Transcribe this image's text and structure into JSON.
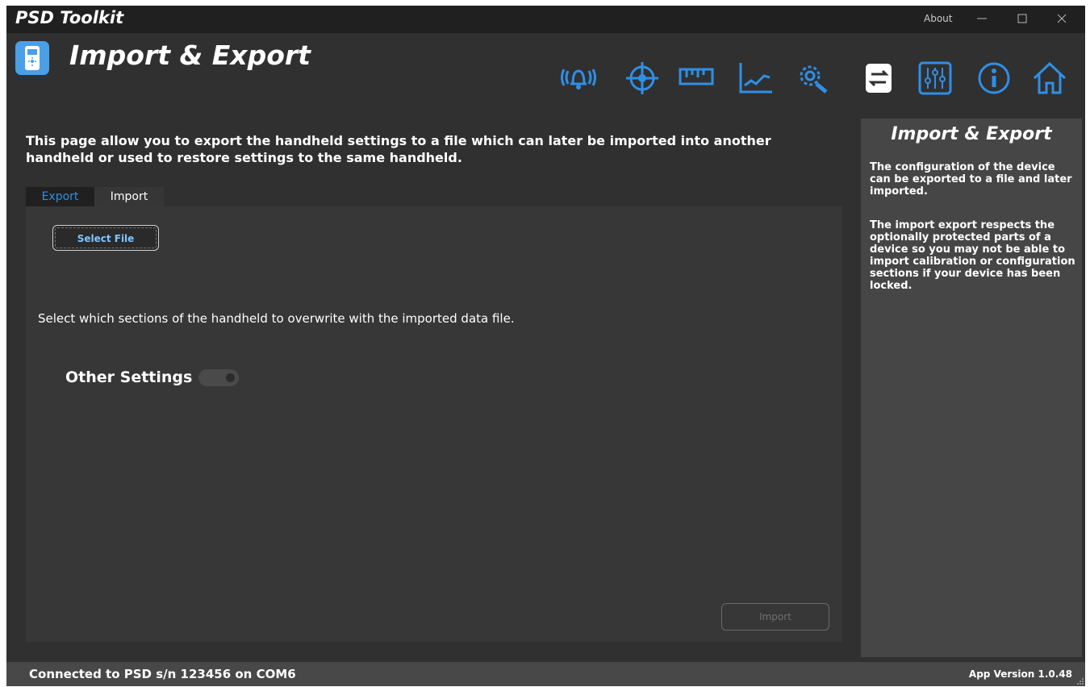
{
  "window": {
    "title": "PSD Toolkit",
    "about_label": "About"
  },
  "header": {
    "page_title": "Import & Export",
    "nav_icons": [
      "alarm-icon",
      "target-icon",
      "ruler-icon",
      "chart-icon",
      "settings-icon",
      "import-export-icon",
      "sliders-icon",
      "info-icon",
      "home-icon"
    ]
  },
  "content": {
    "intro_text": "This page allow you to export the handheld settings to a file which can later be imported into another handheld or used to restore settings to the same handheld.",
    "tabs": [
      {
        "label": "Export",
        "active": true
      },
      {
        "label": "Import",
        "active": false
      }
    ],
    "select_file_label": "Select File",
    "sections_text": "Select which sections of the handheld to overwrite with the imported data file.",
    "other_settings_label": "Other Settings",
    "other_settings_enabled": false,
    "import_button_label": "Import"
  },
  "help": {
    "title": "Import & Export",
    "paragraph1": "The configuration of the device can be exported to a file and later imported.",
    "paragraph2": "The import export respects the optionally protected parts of a device so you may not be able to import calibration or configuration sections if your device has been locked."
  },
  "status": {
    "connection": "Connected to PSD s/n 123456 on COM6",
    "version": "App Version 1.0.48"
  },
  "colors": {
    "accent": "#2f8fe6",
    "background": "#303030",
    "panel": "#373737",
    "help_panel": "#464646"
  }
}
